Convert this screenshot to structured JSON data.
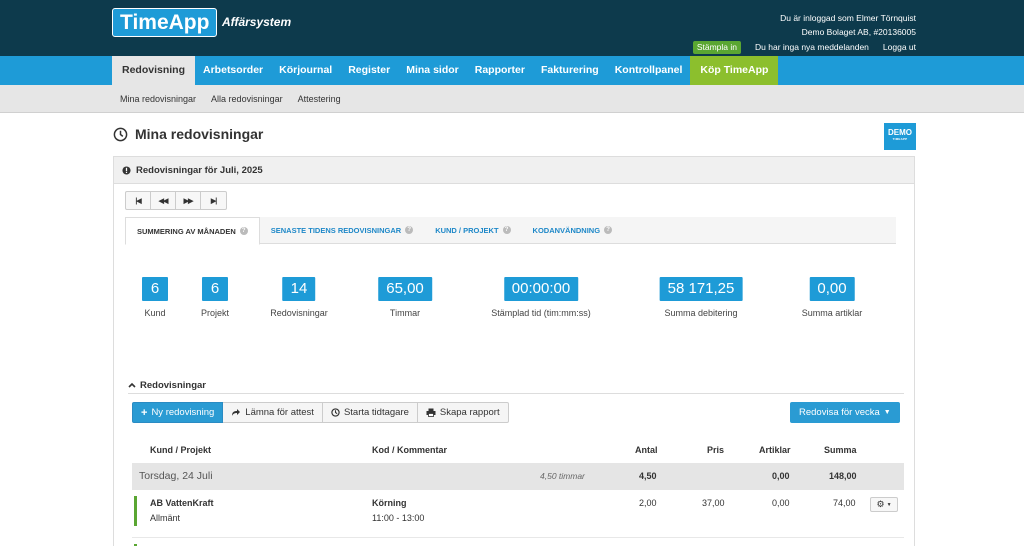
{
  "header": {
    "logo": "TimeApp",
    "subtitle": "Affärsystem",
    "logged_in_as": "Du är inloggad som Elmer Törnquist",
    "company": "Demo Bolaget AB, #20136005",
    "stamp_in": "Stämpla in",
    "messages": "Du har inga nya meddelanden",
    "logout": "Logga ut"
  },
  "nav": {
    "items": [
      "Redovisning",
      "Arbetsorder",
      "Körjournal",
      "Register",
      "Mina sidor",
      "Rapporter",
      "Fakturering",
      "Kontrollpanel"
    ],
    "buy": "Köp TimeApp"
  },
  "subnav": {
    "items": [
      "Mina redovisningar",
      "Alla redovisningar",
      "Attestering"
    ]
  },
  "page": {
    "title": "Mina redovisningar",
    "demo_badge": "DEMO",
    "demo_badge_small": "TIMEAPP"
  },
  "panel": {
    "title": "Redovisningar för Juli, 2025",
    "tabs": [
      "SUMMERING AV MÅNADEN",
      "SENASTE TIDENS REDOVISNINGAR",
      "KUND / PROJEKT",
      "KODANVÄNDNING"
    ],
    "stats": [
      {
        "value": "6",
        "label": "Kund"
      },
      {
        "value": "6",
        "label": "Projekt"
      },
      {
        "value": "14",
        "label": "Redovisningar"
      },
      {
        "value": "65,00",
        "label": "Timmar"
      },
      {
        "value": "00:00:00",
        "label": "Stämplad tid (tim:mm:ss)"
      },
      {
        "value": "58 171,25",
        "label": "Summa debitering"
      },
      {
        "value": "0,00",
        "label": "Summa artiklar"
      }
    ],
    "section_title": "Redovisningar",
    "toolbar": {
      "new": "Ny redovisning",
      "submit": "Lämna för attest",
      "timer": "Starta tidtagare",
      "report": "Skapa rapport",
      "weekly": "Redovisa för vecka"
    },
    "table": {
      "headers": [
        "Kund / Projekt",
        "Kod / Kommentar",
        "Antal",
        "Pris",
        "Artiklar",
        "Summa"
      ],
      "date_row": {
        "date": "Torsdag, 24 Juli",
        "hours": "4,50 timmar",
        "antal": "4,50",
        "artiklar": "0,00",
        "summa": "148,00"
      },
      "entry": {
        "customer": "AB VattenKraft",
        "project": "Allmänt",
        "code": "Körning",
        "time": "11:00 - 13:00",
        "antal": "2,00",
        "pris": "37,00",
        "artiklar": "0,00",
        "summa": "74,00"
      }
    }
  },
  "colors": {
    "brand_dark": "#0d3a4c",
    "brand_blue": "#1e9bd7",
    "buy_green": "#8cbf2d",
    "status_green": "#5aa632"
  }
}
